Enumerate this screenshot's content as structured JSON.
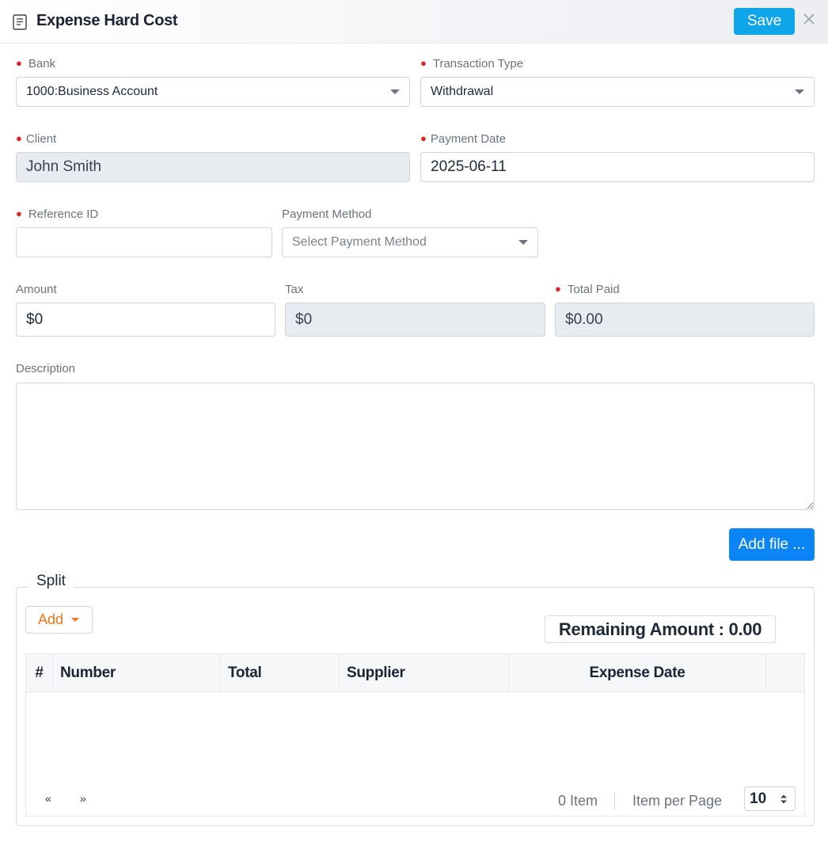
{
  "header": {
    "title": "Expense Hard Cost",
    "save_label": "Save"
  },
  "form": {
    "bank": {
      "label": "Bank",
      "value": "1000:Business Account"
    },
    "transaction_type": {
      "label": "Transaction Type",
      "value": "Withdrawal"
    },
    "client": {
      "label": "Client",
      "value": "John Smith"
    },
    "payment_date": {
      "label": "Payment Date",
      "value": "2025-06-11"
    },
    "reference_id": {
      "label": "Reference ID",
      "value": ""
    },
    "payment_method": {
      "label": "Payment Method",
      "placeholder": "Select Payment Method"
    },
    "amount": {
      "label": "Amount",
      "value": "$0"
    },
    "tax": {
      "label": "Tax",
      "value": "$0"
    },
    "total_paid": {
      "label": "Total Paid",
      "value": "$0.00"
    },
    "description": {
      "label": "Description",
      "value": ""
    },
    "add_file_label": "Add file ..."
  },
  "split": {
    "legend": "Split",
    "add_label": "Add",
    "remaining": "Remaining Amount : 0.00",
    "columns": [
      "#",
      "Number",
      "Total",
      "Supplier",
      "Expense Date"
    ],
    "rows": [],
    "pager": {
      "prev": "«",
      "next": "»"
    },
    "item_count": "0 Item",
    "per_page_label": "Item per Page",
    "per_page_value": "10"
  },
  "colors": {
    "save_button": "#0ea5e9",
    "add_file_button": "#0b84f5",
    "required_dot": "#dc2626",
    "add_accent": "#f97316"
  }
}
